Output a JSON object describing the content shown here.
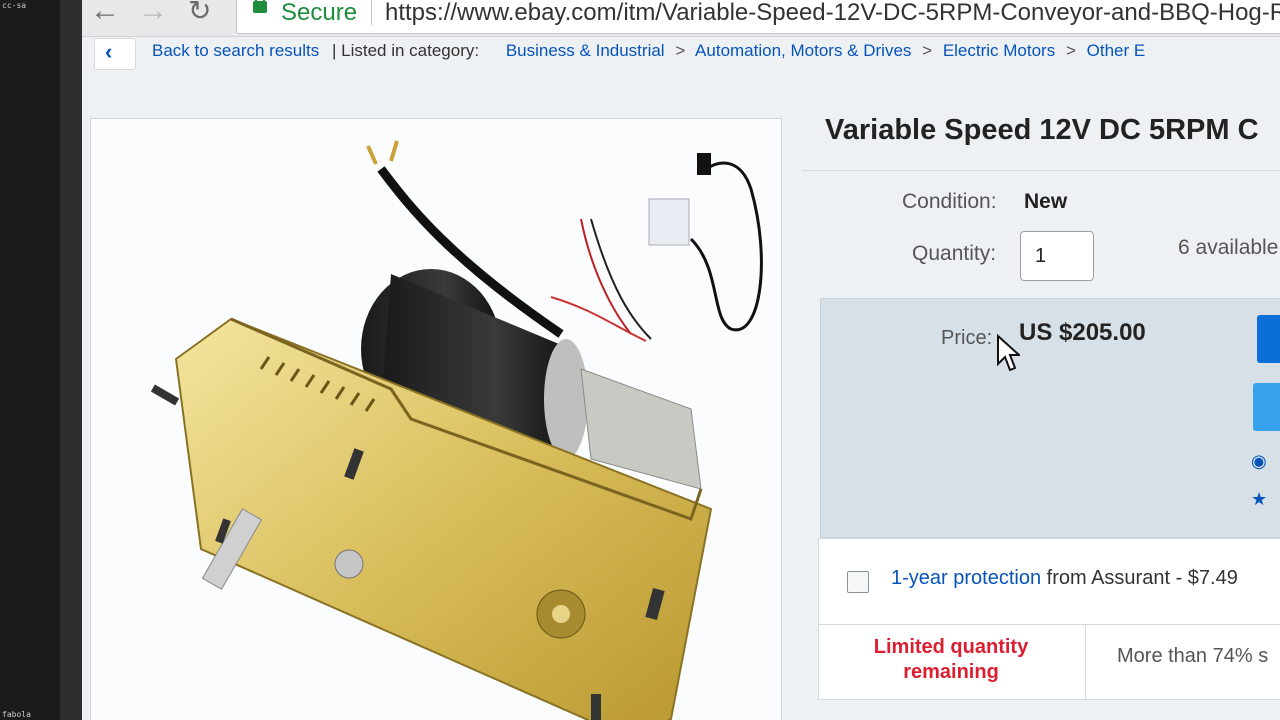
{
  "corner_tags": {
    "top": "cc-sa",
    "bottom": "fabola"
  },
  "browser": {
    "secure_label": "Secure",
    "url": "https://www.ebay.com/itm/Variable-Speed-12V-DC-5RPM-Conveyor-and-BBQ-Hog-R"
  },
  "breadcrumb": {
    "back_label": "Back to search results",
    "listed_label": "| Listed in category:",
    "categories": [
      "Business & Industrial",
      "Automation, Motors & Drives",
      "Electric Motors",
      "Other E"
    ]
  },
  "listing": {
    "title": "Variable Speed 12V DC 5RPM C",
    "condition_label": "Condition:",
    "condition_value": "New",
    "quantity_label": "Quantity:",
    "quantity_value": "1",
    "available_text": "6 available",
    "price_label": "Price:",
    "price_value": "US $205.00",
    "protection_link": "1-year protection",
    "protection_rest": " from Assurant - $7.49",
    "limited_text": "Limited quantity remaining",
    "sold_text": "More than 74% s"
  },
  "colors": {
    "link": "#0654ba",
    "limited": "#dd1e31",
    "secure": "#1e8e3e",
    "buy_button": "#0a6fd6"
  },
  "icons": [
    "back-arrow-icon",
    "forward-arrow-icon",
    "reload-icon",
    "lock-icon",
    "chevron-left-icon",
    "eye-icon",
    "star-icon",
    "cursor-icon"
  ]
}
